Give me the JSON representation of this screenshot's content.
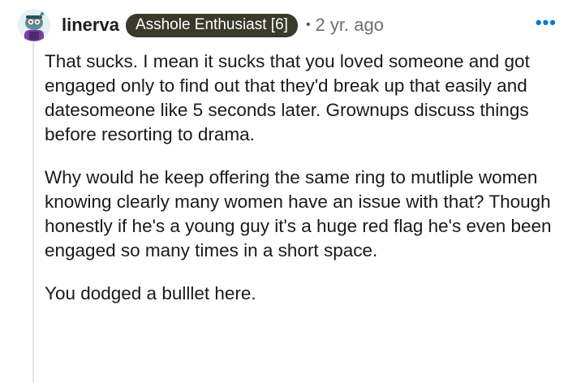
{
  "comment": {
    "author": "linerva",
    "flair": "Asshole Enthusiast [6]",
    "separator": "•",
    "age": "2 yr. ago",
    "more_label": "•••",
    "paragraphs": [
      "That sucks. I mean it sucks that you loved someone and got engaged only to find out that they'd break up that easily and datesomeone like 5 seconds later. Grownups discuss things before resorting to drama.",
      "Why would he keep offering the same ring to mutliple women knowing clearly many women have an issue with that? Though honestly if he's a young guy it's a huge red flag he's even been engaged so many times in a short space.",
      "You dodged a bulllet here."
    ]
  },
  "colors": {
    "flair_bg": "#3a3a2a",
    "more_icon": "#0079d3",
    "thread_line": "#e2e4e6"
  },
  "icons": {
    "avatar": "snoo-avatar",
    "more": "more-options-icon"
  }
}
